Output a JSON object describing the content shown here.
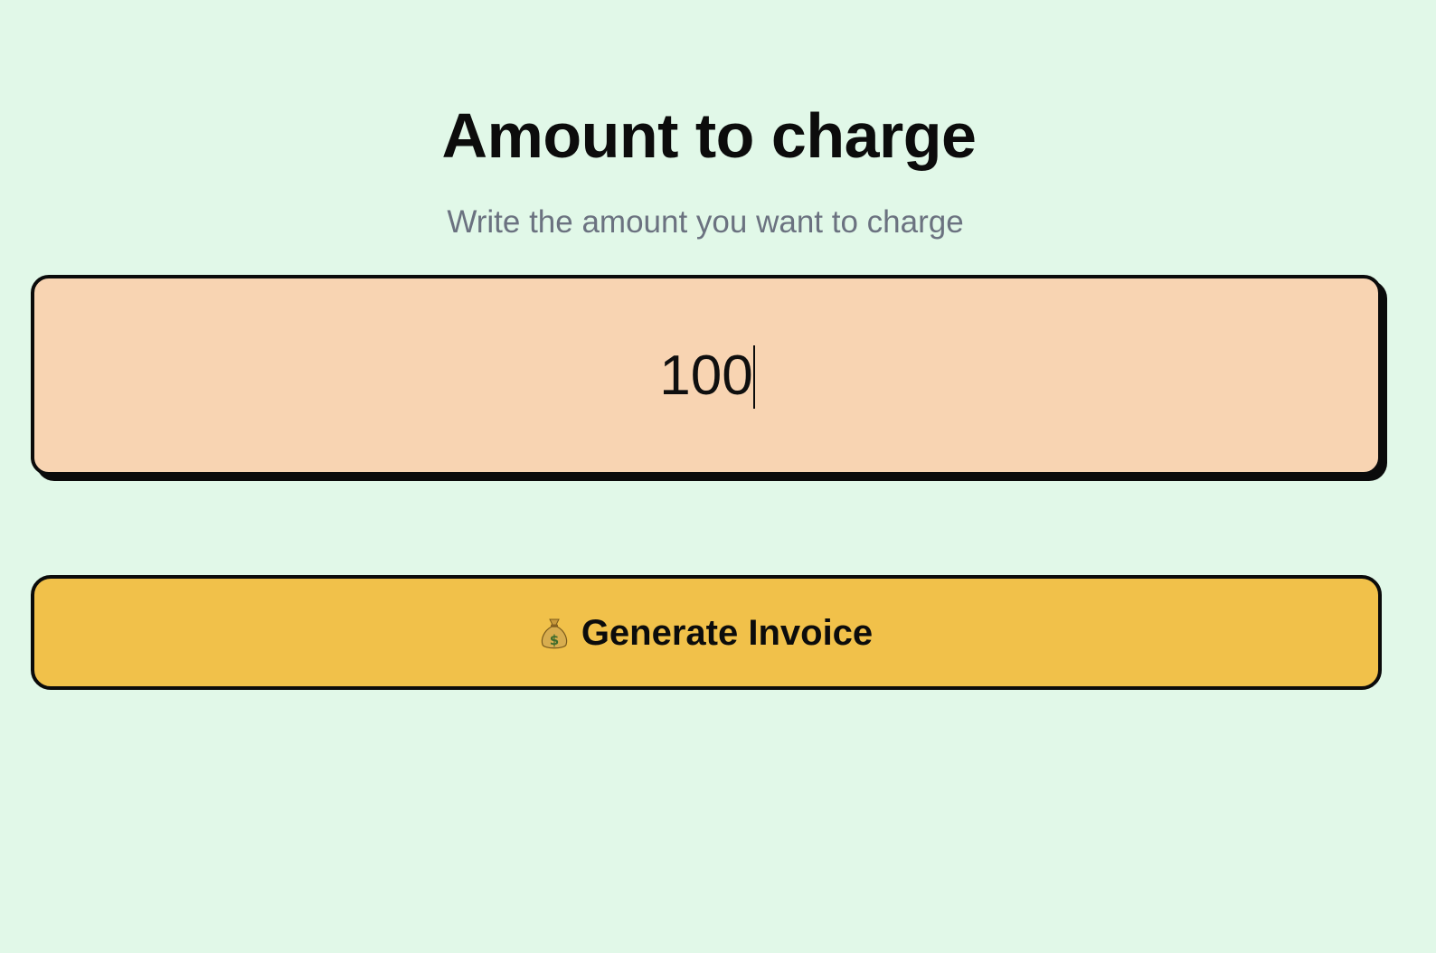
{
  "header": {
    "title": "Amount to charge",
    "subtitle": "Write the amount you want to charge"
  },
  "amount": {
    "value": "100"
  },
  "actions": {
    "generate_icon": "money-bag-icon",
    "generate_label": "Generate Invoice"
  },
  "colors": {
    "background": "#e1f8e8",
    "input_background": "#f8d4b2",
    "button_background": "#f1c14a",
    "border": "#0b0b0b",
    "subtitle_text": "#6b7280"
  }
}
